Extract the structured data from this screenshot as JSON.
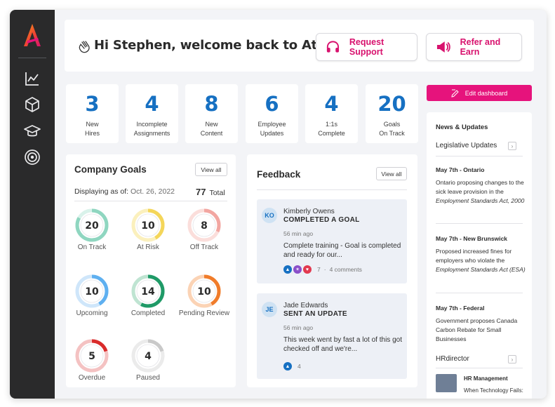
{
  "header": {
    "welcome": "Hi Stephen, welcome back to Atlas",
    "support_label": "Request Support",
    "refer_label": "Refer and Earn",
    "edit_label": "Edit dashboard"
  },
  "stats": [
    {
      "value": "3",
      "line1": "New",
      "line2": "Hires"
    },
    {
      "value": "4",
      "line1": "Incomplete",
      "line2": "Assignments"
    },
    {
      "value": "8",
      "line1": "New",
      "line2": "Content"
    },
    {
      "value": "6",
      "line1": "Employee",
      "line2": "Updates"
    },
    {
      "value": "4",
      "line1": "1:1s",
      "line2": "Complete"
    },
    {
      "value": "20",
      "line1": "Goals",
      "line2": "On Track"
    }
  ],
  "goals": {
    "title": "Company Goals",
    "view_all": "View all",
    "displaying_label": "Displaying as of:",
    "date": "Oct. 26, 2022",
    "total_value": "77",
    "total_label": "Total",
    "items": [
      {
        "value": "20",
        "label": "On Track",
        "color": "#8fd6c0",
        "light": "#d9f2ea",
        "fraction": 0.26
      },
      {
        "value": "10",
        "label": "At Risk",
        "color": "#f4d65a",
        "light": "#fbf0bd",
        "fraction": 0.13
      },
      {
        "value": "8",
        "label": "Off Track",
        "color": "#f2a6a1",
        "light": "#fbdedb",
        "fraction": 0.1
      },
      {
        "value": "10",
        "label": "Upcoming",
        "color": "#5fb0f0",
        "light": "#cfe6fa",
        "fraction": 0.13
      },
      {
        "value": "14",
        "label": "Completed",
        "color": "#1f9a67",
        "light": "#bfe4d2",
        "fraction": 0.18
      },
      {
        "value": "10",
        "label": "Pending Review",
        "color": "#f07c2a",
        "light": "#fbd3b5",
        "fraction": 0.13
      },
      {
        "value": "5",
        "label": "Overdue",
        "color": "#d92b2b",
        "light": "#f4c2c2",
        "fraction": 0.06
      },
      {
        "value": "4",
        "label": "Paused",
        "color": "#c9c9c9",
        "light": "#ebebeb",
        "fraction": 0.05
      }
    ]
  },
  "feedback": {
    "title": "Feedback",
    "view_all": "View all",
    "items": [
      {
        "initials": "KO",
        "name": "Kimberly Owens",
        "action": "COMPLETED A GOAL",
        "time": "56 min ago",
        "body": "Complete training - Goal is completed and ready for our...",
        "react_count": "7",
        "separator": "·",
        "comments": "4 comments"
      },
      {
        "initials": "JE",
        "name": "Jade Edwards",
        "action": "SENT AN UPDATE",
        "time": "56 min ago",
        "body": "This week went by fast a lot of this got checked off and we're...",
        "react_count": "4"
      }
    ]
  },
  "news": {
    "title": "News & Updates",
    "section1": "Legislative Updates",
    "section2": "HRdirector",
    "items": [
      {
        "date": "May 7th - Ontario",
        "text": "Ontario proposing changes to the sick leave provision in the",
        "italic": "Employment Standards Act, 2000"
      },
      {
        "date": "May 7th - New Brunswick",
        "text": "Proposed increased fines for employers who violate the",
        "italic": "Employment Standards Act (ESA)"
      },
      {
        "date": "May 7th - Federal",
        "text": "Government proposes Canada Carbon Rebate for Small Businesses",
        "italic": ""
      }
    ],
    "hr_heading": "HR Management",
    "hr_sub": "When Technology Fails:"
  }
}
